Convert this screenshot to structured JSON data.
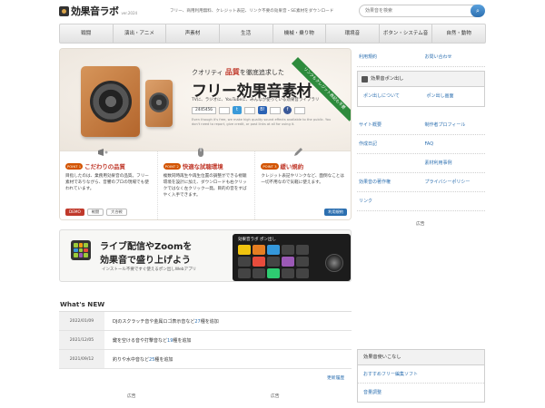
{
  "header": {
    "logo_text": "効果音ラボ",
    "logo_version": "ver.2024",
    "tagline": "フリー、商用利用無料、クレジット表記、リンク不要の効果音・SE素材をダウンロード",
    "search_placeholder": "効果音を検索",
    "search_icon": "search-icon"
  },
  "nav": {
    "items": [
      "戦闘",
      "演出・アニメ",
      "声素材",
      "生活",
      "機械・乗り物",
      "環境音",
      "ボタン・システム音",
      "自然・動物"
    ]
  },
  "hero": {
    "catch_prefix": "クオリティ",
    "catch_red": "品質",
    "catch_rest": "を徹底追求した",
    "title": "フリー効果音素材",
    "subtitle": "TVに、ラジオに、YouTubeに、みんなが使っている効果音ライブラリ",
    "badge": "リンクもクレジット表記も不要",
    "counter": "2445456",
    "note": "Even though it's free, we make high quality sound effects available to the public. You don't need to report, give credit, or post links at all for using it.",
    "points": [
      {
        "num": "POINT 1",
        "title": "こだわりの品質",
        "text": "目指したのは、業務用効果音の品質。フリー素材でありながら、音響のプロの現場でも使われています。",
        "btn_demo": "DEMO",
        "btn_1": "戦闘",
        "btn_2": "大合戦"
      },
      {
        "num": "POINT 2",
        "title": "快適な試聴環境",
        "text": "複数同時再生や再生位置の調整ができる視聴環境を設計に加え、ダウンロードも右クリックではなく左クリック一発。目的の音をすばやく入手できます。"
      },
      {
        "num": "POINT 3",
        "title": "緩い規約",
        "text": "クレジット表記やリンクなど、面倒なことは一切不用なので気軽に使えます。",
        "btn": "利用規約"
      }
    ]
  },
  "live": {
    "line1": "ライブ配信やZoomを",
    "line2": "効果音で盛り上げよう",
    "note": "インストール不要ですぐ使えるポン出しWebアプリ",
    "app_title": "効果音ラボ ポン出し"
  },
  "news": {
    "title": "What's NEW",
    "rows": [
      {
        "date": "2022/01/09",
        "prefix": "DJのスクラッチ音や金属ロゴ表示音など",
        "count": "27",
        "suffix": "種を追加"
      },
      {
        "date": "2021/12/05",
        "prefix": "鍵を空ける音や打撃音など",
        "count": "19",
        "suffix": "種を追加"
      },
      {
        "date": "2021/09/12",
        "prefix": "釣りや水中音など",
        "count": "25",
        "suffix": "種を追加"
      }
    ],
    "more": "更新履歴",
    "ad_left": "広告",
    "ad_mid": "広告"
  },
  "sidebar": {
    "row1": [
      "利用規約",
      "お問い合わせ"
    ],
    "box_title": "効果音ポン出し",
    "box_links": [
      "ポン出しについて",
      "ポン出し画面"
    ],
    "links": [
      [
        "サイト概要",
        "制作者プロフィール"
      ],
      [
        "作成日記",
        "FAQ"
      ],
      [
        "",
        "素材利用事例"
      ],
      [
        "効果音の著作権",
        "プライバシーポリシー"
      ],
      [
        "リンク",
        ""
      ]
    ],
    "ad": "広告",
    "box2_title": "効果音使いこなし",
    "box2_items": [
      "おすすめフリー編集ソフト",
      "音量調整"
    ]
  }
}
